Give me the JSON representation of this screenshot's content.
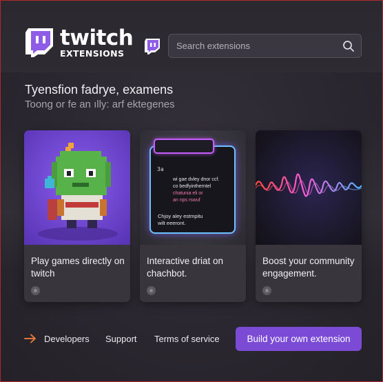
{
  "header": {
    "logo_word": "twitch",
    "logo_sub": "EXTENSIONS",
    "search_placeholder": "Search extensions"
  },
  "hero": {
    "title": "Tyensfion fadrye, examens",
    "subtitle": "Toong or fe an ılly: arf ektegenes"
  },
  "cards": [
    {
      "title": "Play games directly on twitch",
      "image_icon": "pixel-goblin-character"
    },
    {
      "title": "Interactive driat on chachbot.",
      "image_icon": "chat-widget",
      "chat_widget": {
        "count": "3a",
        "lines": [
          "wi gae dvley dnor ccf.",
          "co bedfyintherntel",
          "chatunia eli or",
          "an nps rswuf"
        ],
        "notes": [
          "Chjoy aley estmpitu",
          "wilt eeeront."
        ]
      }
    },
    {
      "title": "Boost your community engagement.",
      "image_icon": "sound-wave"
    }
  ],
  "footer": {
    "links": [
      "Developers",
      "Support",
      "Terms of service"
    ],
    "cta_label": "Build your own extension"
  },
  "colors": {
    "brand_purple": "#7b4bd6",
    "accent_orange": "#e0733a",
    "frame_border": "#b3262b"
  }
}
